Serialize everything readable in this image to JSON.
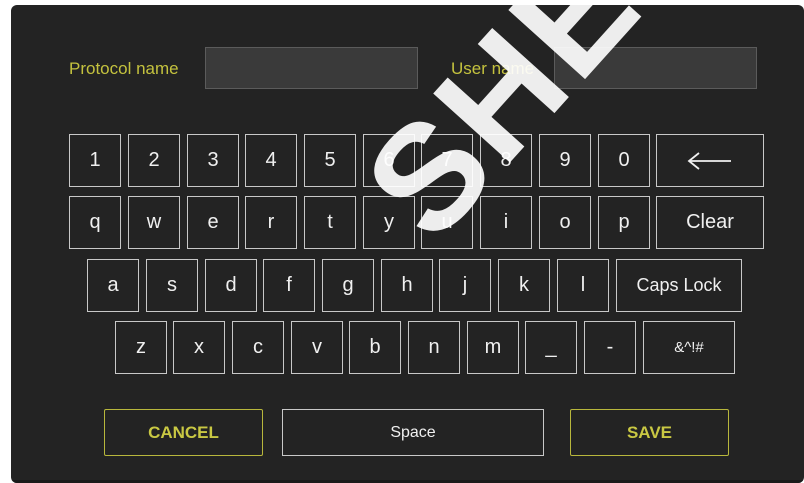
{
  "fields": {
    "protocol_label": "Protocol name",
    "protocol_value": "",
    "user_label": "User name",
    "user_value": ""
  },
  "keyboard": {
    "row1": [
      "1",
      "2",
      "3",
      "4",
      "5",
      "6",
      "7",
      "8",
      "9",
      "0"
    ],
    "backspace_icon": "arrow-left-icon",
    "row2": [
      "q",
      "w",
      "e",
      "r",
      "t",
      "y",
      "u",
      "i",
      "o",
      "p"
    ],
    "clear_label": "Clear",
    "row3": [
      "a",
      "s",
      "d",
      "f",
      "g",
      "h",
      "j",
      "k",
      "l"
    ],
    "caps_label": "Caps Lock",
    "row4": [
      "z",
      "x",
      "c",
      "v",
      "b",
      "n",
      "m",
      "_",
      "-"
    ],
    "symbols_label": "&^!#"
  },
  "actions": {
    "cancel_label": "CANCEL",
    "space_label": "Space",
    "save_label": "SAVE"
  },
  "colors": {
    "background": "#232323",
    "accent": "#c4c23e",
    "key_border": "#c8c8c8"
  },
  "watermark": "SHER SA"
}
